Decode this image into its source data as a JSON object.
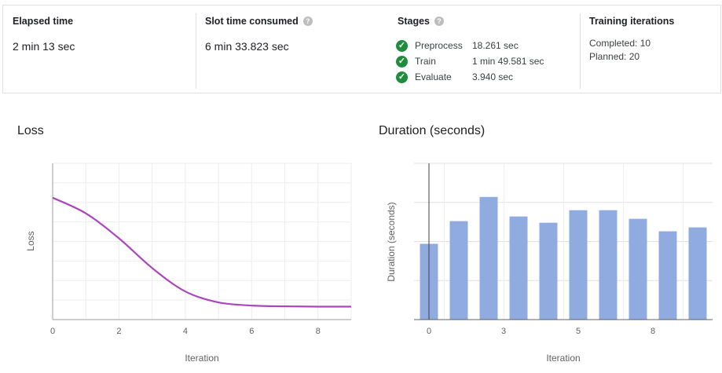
{
  "summary": {
    "elapsed": {
      "title": "Elapsed time",
      "value": "2 min 13 sec"
    },
    "slot": {
      "title": "Slot time consumed",
      "value": "6 min 33.823 sec",
      "help_icon": "help-icon"
    },
    "stages": {
      "title": "Stages",
      "help_icon": "help-icon",
      "items": [
        {
          "name": "Preprocess",
          "time": "18.261 sec",
          "status_icon": "check-circle-icon"
        },
        {
          "name": "Train",
          "time": "1 min 49.581 sec",
          "status_icon": "check-circle-icon"
        },
        {
          "name": "Evaluate",
          "time": "3.940 sec",
          "status_icon": "check-circle-icon"
        }
      ]
    },
    "iterations": {
      "title": "Training iterations",
      "completed": "Completed: 10",
      "planned": "Planned: 20"
    }
  },
  "colors": {
    "success": "#1e8e3e",
    "loss_line": "#ab47bc",
    "bar": "#8fabe0"
  },
  "chart_data": [
    {
      "type": "line",
      "title": "Loss",
      "xlabel": "Iteration",
      "ylabel": "Loss",
      "xlim": [
        0,
        9
      ],
      "x_ticks": [
        "0",
        "2",
        "4",
        "6",
        "8"
      ],
      "grid": true,
      "x": [
        0,
        1,
        2,
        3,
        4,
        5,
        6,
        7,
        8,
        9
      ],
      "y": [
        0.78,
        0.68,
        0.52,
        0.33,
        0.18,
        0.11,
        0.09,
        0.085,
        0.083,
        0.083
      ],
      "color": "#ab47bc"
    },
    {
      "type": "bar",
      "title": "Duration (seconds)",
      "xlabel": "Iteration",
      "ylabel": "Duration (seconds)",
      "x_ticks": [
        "0",
        "3",
        "5",
        "8"
      ],
      "grid": true,
      "categories": [
        "0",
        "1",
        "2",
        "3",
        "4",
        "5",
        "6",
        "7",
        "8",
        "9"
      ],
      "values": [
        9.7,
        12.6,
        15.7,
        13.2,
        12.4,
        14.0,
        14.0,
        12.9,
        11.3,
        11.8
      ],
      "ylim": [
        0,
        20
      ],
      "color": "#8fabe0"
    }
  ]
}
